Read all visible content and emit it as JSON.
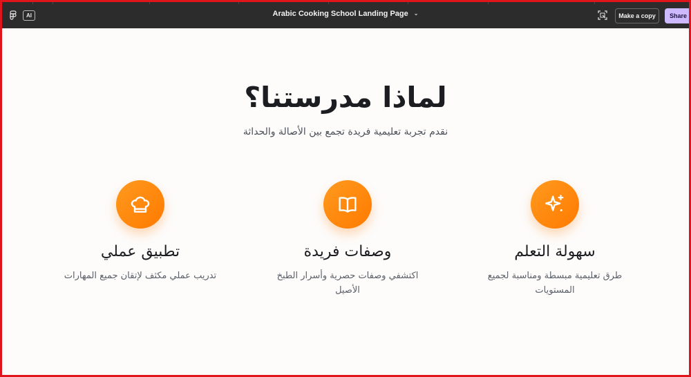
{
  "topbar": {
    "ai_label": "AI",
    "title": "Arabic Cooking School Landing Page",
    "make_copy_label": "Make a copy",
    "share_label": "Share"
  },
  "section": {
    "heading": "لماذا مدرستنا؟",
    "subheading": "نقدم تجربة تعليمية فريدة تجمع بين الأصالة والحداثة"
  },
  "features": [
    {
      "icon": "chef-hat-icon",
      "title": "تطبيق عملي",
      "desc": "تدريب عملي مكثف لإتقان جميع المهارات"
    },
    {
      "icon": "book-icon",
      "title": "وصفات فريدة",
      "desc": "اكتشفي وصفات حصرية وأسرار الطبخ الأصيل"
    },
    {
      "icon": "sparkles-icon",
      "title": "سهولة التعلم",
      "desc": "طرق تعليمية مبسطة ومناسبة لجميع المستويات"
    }
  ],
  "colors": {
    "accent_orange": "#ff8200",
    "share_button": "#cdb9ff",
    "topbar": "#2c2c2c",
    "frame_border": "#e0141b"
  }
}
